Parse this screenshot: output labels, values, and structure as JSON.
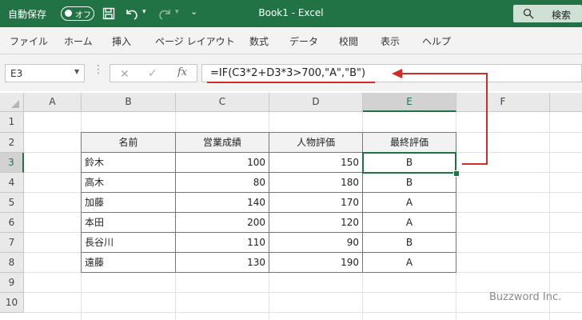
{
  "titlebar": {
    "autosave_label": "自動保存",
    "toggle_text": "オフ",
    "doc_title": "Book1  -  Excel",
    "search_label": "検索",
    "accent": "#217346"
  },
  "ribbon": {
    "tabs": [
      "ファイル",
      "ホーム",
      "挿入",
      "ページ レイアウト",
      "数式",
      "データ",
      "校閲",
      "表示",
      "ヘルプ"
    ]
  },
  "formula_bar": {
    "name_box": "E3",
    "formula": "=IF(C3*2+D3*3>700,\"A\",\"B\")",
    "annotation_color": "#d32a2a"
  },
  "sheet": {
    "columns": [
      "A",
      "B",
      "C",
      "D",
      "E",
      "F"
    ],
    "selected_column": "E",
    "rows": [
      "1",
      "2",
      "3",
      "4",
      "5",
      "6",
      "7",
      "8",
      "9",
      "10"
    ],
    "selected_row": "3",
    "table": {
      "headers": [
        "名前",
        "営業成績",
        "人物評価",
        "最終評価"
      ],
      "rows": [
        [
          "鈴木",
          "100",
          "150",
          "B"
        ],
        [
          "高木",
          "80",
          "180",
          "B"
        ],
        [
          "加藤",
          "140",
          "170",
          "A"
        ],
        [
          "本田",
          "200",
          "120",
          "A"
        ],
        [
          "長谷川",
          "110",
          "90",
          "B"
        ],
        [
          "遠藤",
          "130",
          "190",
          "A"
        ]
      ]
    }
  },
  "watermark": "Buzzword Inc."
}
